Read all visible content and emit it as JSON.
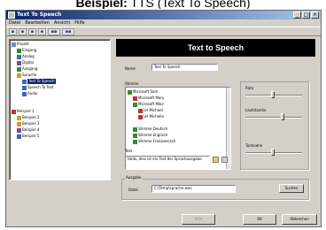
{
  "caption": {
    "bold": "Beispiel:",
    "rest": " TTS (Text To Speech)"
  },
  "window": {
    "title": "Text To Speech",
    "menu": [
      "Datei",
      "Bearbeiten",
      "Ansicht",
      "Hilfe"
    ]
  },
  "panel": {
    "heading": "Text to Speech",
    "name_label": "Name",
    "name_value": "Text To Speech",
    "voice_label": "Stimme",
    "speed_label": "Rate",
    "volume_label": "Lautstaerke",
    "pitch_label": "Tonhoehe",
    "text_label": "Text",
    "text_value": "Hallo, dies ist ein Test der Sprachausgabe.",
    "output_group": "Ausgabe",
    "output_label": "Datei",
    "output_value": "C:\\Temp\\sprache.wav",
    "browse_label": "Suchen",
    "voice_items": [
      "Microsoft Sam",
      "Microsoft Mary",
      "Microsoft Mike",
      "LH Michael",
      "LH Michelle",
      "Stimme Deutsch",
      "Stimme Englisch",
      "Stimme Franzoesisch"
    ]
  },
  "tree": {
    "items": [
      "Projekt",
      "Eingang",
      "Analog",
      "Digital",
      "Ausgang",
      "Sprache",
      "Text To Speech",
      "Speech To Text",
      "Audio",
      "Beispiel 1",
      "Beispiel 2",
      "Beispiel 3",
      "Beispiel 4",
      "Beispiel 5"
    ]
  },
  "footer": {
    "left_label": "Hilfe",
    "ok_label": "OK",
    "cancel_label": "Abbrechen"
  }
}
